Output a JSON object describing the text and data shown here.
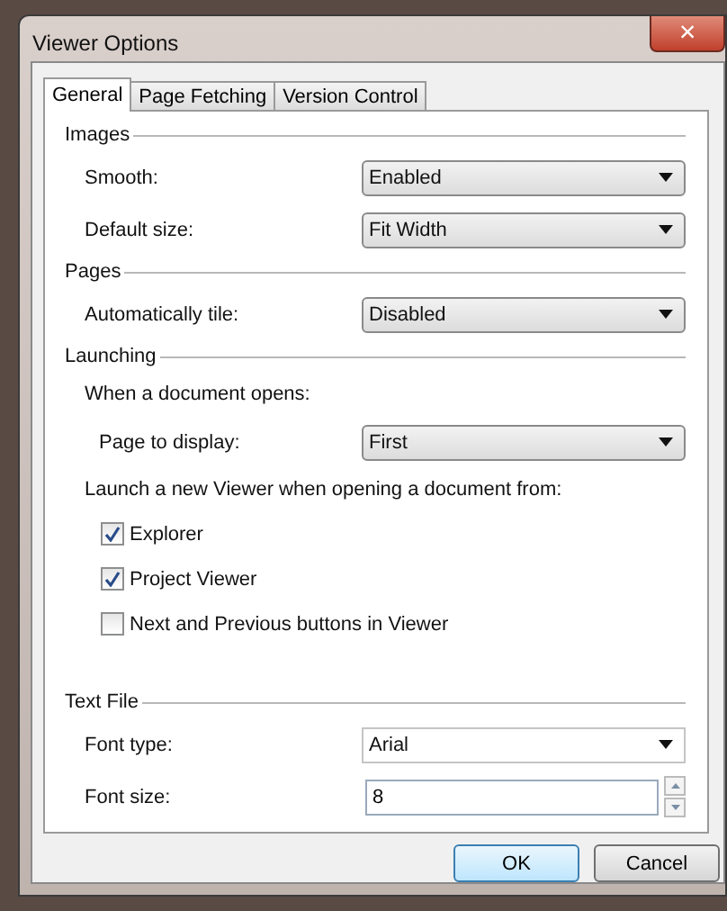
{
  "window": {
    "title": "Viewer Options",
    "close": "×"
  },
  "tabs": [
    {
      "label": "General",
      "selected": true
    },
    {
      "label": "Page Fetching",
      "selected": false
    },
    {
      "label": "Version Control",
      "selected": false
    }
  ],
  "sections": [
    {
      "title": "Images",
      "items": [
        {
          "kind": "select",
          "label": "Smooth:",
          "value": "Enabled"
        },
        {
          "kind": "select",
          "label": "Default size:",
          "value": "Fit Width"
        }
      ]
    },
    {
      "title": "Pages",
      "items": [
        {
          "kind": "select",
          "label": "Automatically tile:",
          "value": "Disabled"
        }
      ]
    },
    {
      "title": "Launching",
      "items": [
        {
          "kind": "text",
          "label": "When a document opens:"
        },
        {
          "kind": "select",
          "label": "Page to display:",
          "value": "First",
          "indent": true
        },
        {
          "kind": "text",
          "label": "Launch a new Viewer when opening a document from:"
        },
        {
          "kind": "checkbox",
          "label": "Explorer",
          "checked": true
        },
        {
          "kind": "checkbox",
          "label": "Project Viewer",
          "checked": true
        },
        {
          "kind": "checkbox",
          "label": "Next and Previous buttons in Viewer",
          "checked": false
        }
      ]
    },
    {
      "title": "Text File",
      "items": [
        {
          "kind": "combo",
          "label": "Font type:",
          "value": "Arial"
        },
        {
          "kind": "spinner",
          "label": "Font size:",
          "value": "8"
        }
      ]
    }
  ],
  "buttons": [
    {
      "label": "OK",
      "default": true
    },
    {
      "label": "Cancel",
      "default": false
    }
  ]
}
